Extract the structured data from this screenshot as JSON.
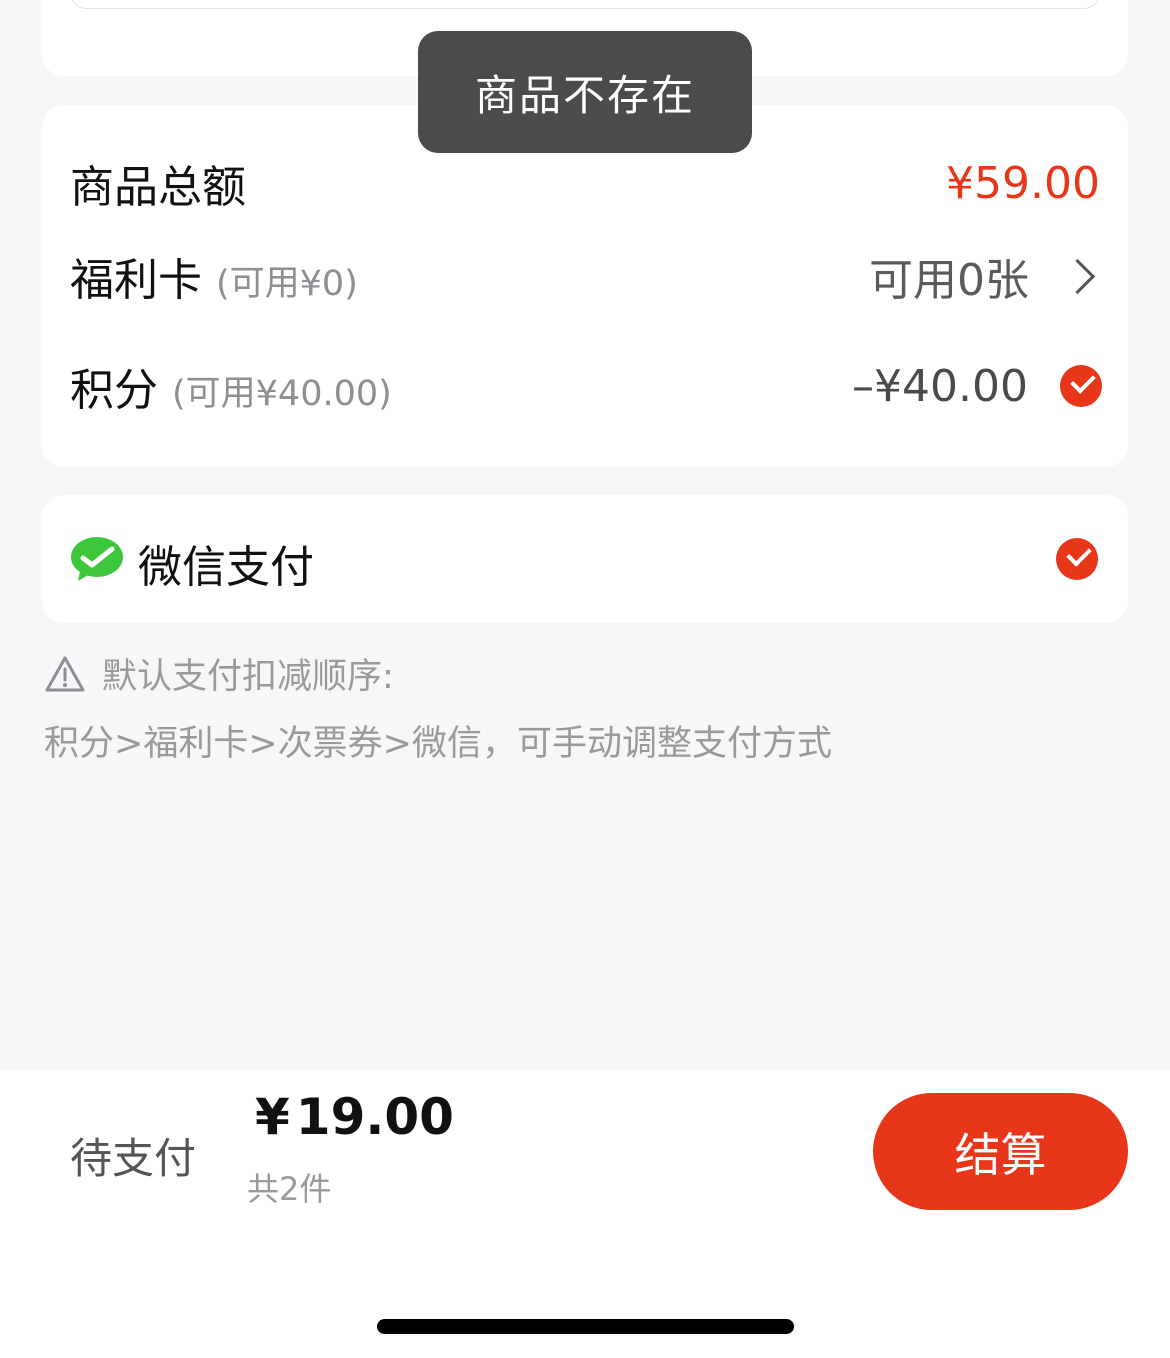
{
  "toast": {
    "message": "商品不存在"
  },
  "summary": {
    "total_label": "商品总额",
    "total_value": "¥59.00",
    "welfare_card_label": "福利卡",
    "welfare_card_available": "(可用¥0)",
    "welfare_card_count": "可用0张",
    "points_label": "积分",
    "points_available": "(可用¥40.00)",
    "points_deduction": "–¥40.00"
  },
  "payment": {
    "method_label": "微信支付",
    "method_icon": "wechat-icon"
  },
  "notice": {
    "icon": "warning-icon",
    "title": "默认支付扣减顺序:",
    "detail": "积分>福利卡>次票券>微信，可手动调整支付方式"
  },
  "bottom_bar": {
    "pending_label": "待支付",
    "currency": "¥",
    "amount": "19.00",
    "item_count": "共2件",
    "checkout_label": "结算"
  },
  "colors": {
    "accent": "#e8361a",
    "wechat_green": "#3fc73c",
    "background": "#f6f7f9",
    "toast_bg": "#4b4b4b"
  }
}
